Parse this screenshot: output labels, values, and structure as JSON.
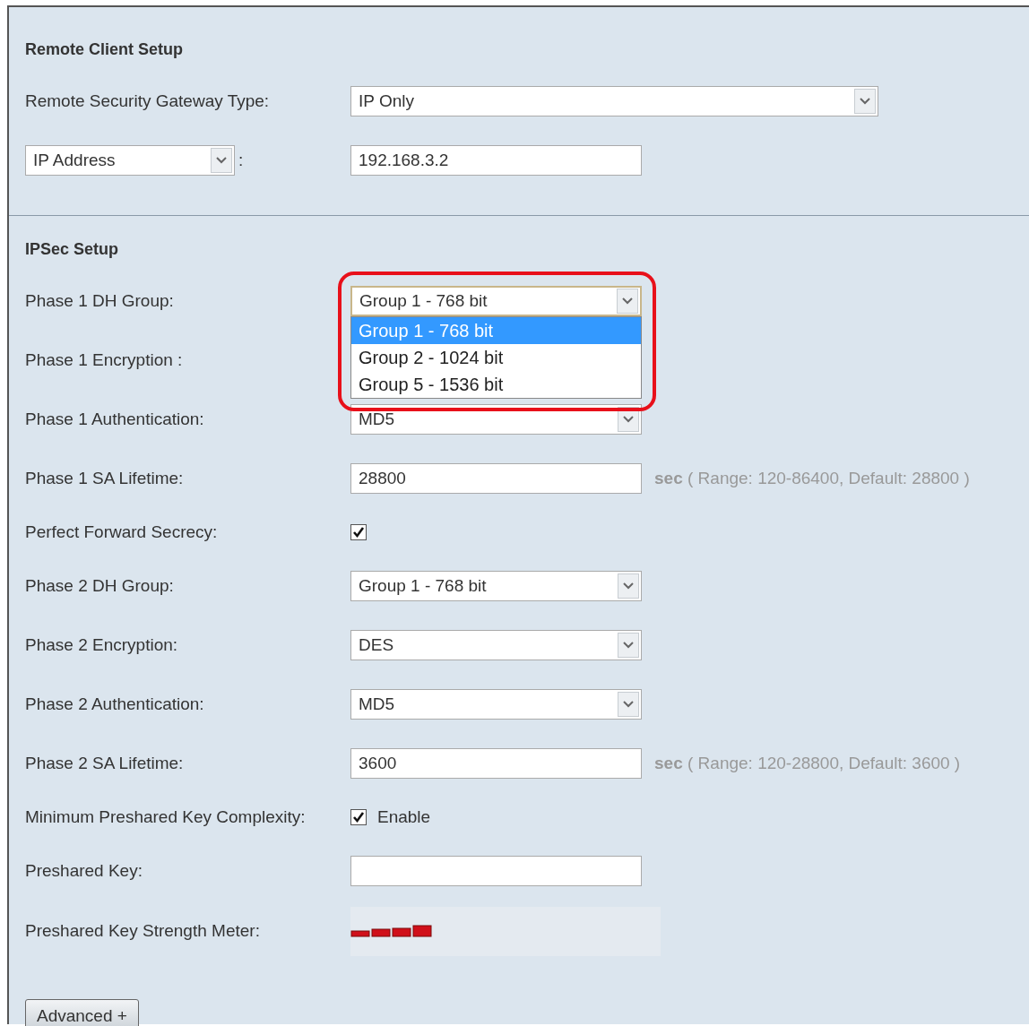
{
  "sections": [
    {
      "heading": "Remote Client Setup",
      "rows": [
        {
          "kind": "wide-select",
          "label": "Remote Security Gateway Type:",
          "value": "IP Only",
          "open": false
        },
        {
          "kind": "labeled-select",
          "select": "IP Address",
          "separator": ":",
          "value": "192.168.3.2"
        }
      ]
    },
    {
      "heading": "IPSec Setup",
      "rows": [
        {
          "kind": "select",
          "label": "Phase 1 DH Group:",
          "value": "Group 1 - 768 bit",
          "open": true,
          "options": [
            {
              "label": "Group 1 - 768 bit",
              "selected": true
            },
            {
              "label": "Group 2 - 1024 bit",
              "selected": false
            },
            {
              "label": "Group 5 - 1536 bit",
              "selected": false
            }
          ],
          "highlighted": true
        },
        {
          "kind": "covered",
          "label": "Phase 1 Encryption :"
        },
        {
          "kind": "select",
          "label": "Phase 1 Authentication:",
          "value": "MD5",
          "open": false
        },
        {
          "kind": "text",
          "label": "Phase 1 SA Lifetime:",
          "value": "28800",
          "hint": "**sec** ( Range: 120-86400, Default: 28800 )"
        },
        {
          "kind": "checkbox",
          "label": "Perfect Forward Secrecy:",
          "checked": true
        },
        {
          "kind": "select",
          "label": "Phase 2 DH Group:",
          "value": "Group 1 - 768 bit",
          "open": false
        },
        {
          "kind": "select",
          "label": "Phase 2 Encryption:",
          "value": "DES",
          "open": false
        },
        {
          "kind": "select",
          "label": "Phase 2 Authentication:",
          "value": "MD5",
          "open": false
        },
        {
          "kind": "text",
          "label": "Phase 2 SA Lifetime:",
          "value": "3600",
          "hint": "**sec** ( Range: 120-28800, Default: 3600 )"
        },
        {
          "kind": "checkbox",
          "label": "Minimum Preshared Key Complexity:",
          "checked": true,
          "text": "Enable"
        },
        {
          "kind": "text",
          "label": "Preshared Key:"
        },
        {
          "kind": "meter",
          "label": "Preshared Key Strength Meter:"
        }
      ]
    }
  ],
  "button": "Advanced +"
}
